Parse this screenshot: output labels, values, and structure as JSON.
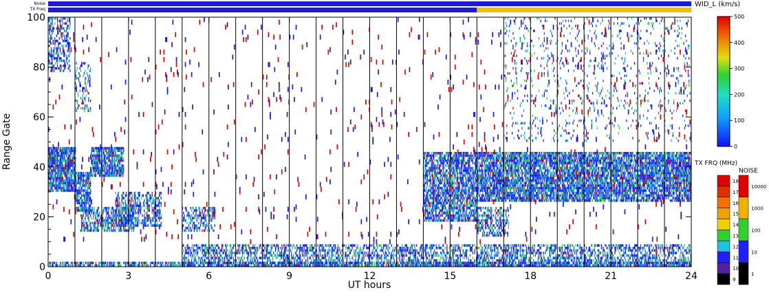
{
  "chart_data": {
    "type": "heatmap",
    "xlabel": "UT hours",
    "ylabel": "Range Gate",
    "xlim": [
      0,
      24
    ],
    "ylim": [
      0,
      100
    ],
    "xticks": [
      "0",
      "3",
      "6",
      "9",
      "12",
      "15",
      "18",
      "21",
      "24"
    ],
    "yticks": [
      "0",
      "20",
      "40",
      "60",
      "80",
      "100"
    ],
    "hour_lines": [
      1,
      2,
      3,
      4,
      5,
      6,
      7,
      8,
      9,
      10,
      11,
      12,
      13,
      14,
      15,
      16,
      17,
      18,
      19,
      20,
      21,
      22,
      23
    ],
    "top_strips": [
      {
        "label": "Noise",
        "base_color": "#1a1ad8"
      },
      {
        "label": "TX Freq",
        "segments": [
          {
            "from": 0,
            "to": 16,
            "color": "#1a1ad8"
          },
          {
            "from": 16,
            "to": 24,
            "color": "#f0c000"
          }
        ]
      }
    ],
    "colorbars": [
      {
        "title": "WID_L (km/s)",
        "ticks": [
          "500",
          "400",
          "300",
          "200",
          "100",
          "0"
        ]
      },
      {
        "title": "TX FRQ (MHz)",
        "levels": [
          "18",
          "17",
          "16",
          "15",
          "14",
          "13",
          "12",
          "11",
          "10",
          "9"
        ],
        "colors": [
          "#e00000",
          "#e03000",
          "#f07000",
          "#f0a000",
          "#f0d000",
          "#30d030",
          "#20c0e0",
          "#2020ff",
          "#5020a0",
          "#000000"
        ]
      },
      {
        "title": "NOISE",
        "levels": [
          "10000",
          "1000",
          "100",
          "10",
          "1"
        ],
        "colors": [
          "#e00000",
          "#f0b000",
          "#30d030",
          "#2020ff",
          "#000000"
        ]
      }
    ],
    "scatter_regions": [
      {
        "t0": 0.0,
        "t1": 1.0,
        "g0": 30,
        "g1": 48,
        "density": 0.85
      },
      {
        "t0": 1.0,
        "t1": 1.6,
        "g0": 22,
        "g1": 38,
        "density": 0.8
      },
      {
        "t0": 1.6,
        "t1": 2.8,
        "g0": 36,
        "g1": 48,
        "density": 0.8
      },
      {
        "t0": 1.2,
        "t1": 3.2,
        "g0": 14,
        "g1": 24,
        "density": 0.6
      },
      {
        "t0": 2.5,
        "t1": 4.2,
        "g0": 16,
        "g1": 30,
        "density": 0.5
      },
      {
        "t0": 5.0,
        "t1": 6.2,
        "g0": 14,
        "g1": 24,
        "density": 0.5
      },
      {
        "t0": 5.0,
        "t1": 24.0,
        "g0": 0,
        "g1": 9,
        "density": 0.5
      },
      {
        "t0": 0.0,
        "t1": 24.0,
        "g0": 0,
        "g1": 2,
        "density": 0.7
      },
      {
        "t0": 14.0,
        "t1": 16.0,
        "g0": 18,
        "g1": 46,
        "density": 0.7
      },
      {
        "t0": 16.0,
        "t1": 24.0,
        "g0": 26,
        "g1": 46,
        "density": 0.8
      },
      {
        "t0": 16.0,
        "t1": 17.2,
        "g0": 12,
        "g1": 24,
        "density": 0.5
      },
      {
        "t0": 0.0,
        "t1": 0.8,
        "g0": 78,
        "g1": 100,
        "density": 0.4
      },
      {
        "t0": 1.0,
        "t1": 1.6,
        "g0": 62,
        "g1": 82,
        "density": 0.3
      },
      {
        "t0": 17.0,
        "t1": 24.0,
        "g0": 50,
        "g1": 100,
        "density": 0.08
      }
    ],
    "sparse_noise_density": 0.012
  }
}
